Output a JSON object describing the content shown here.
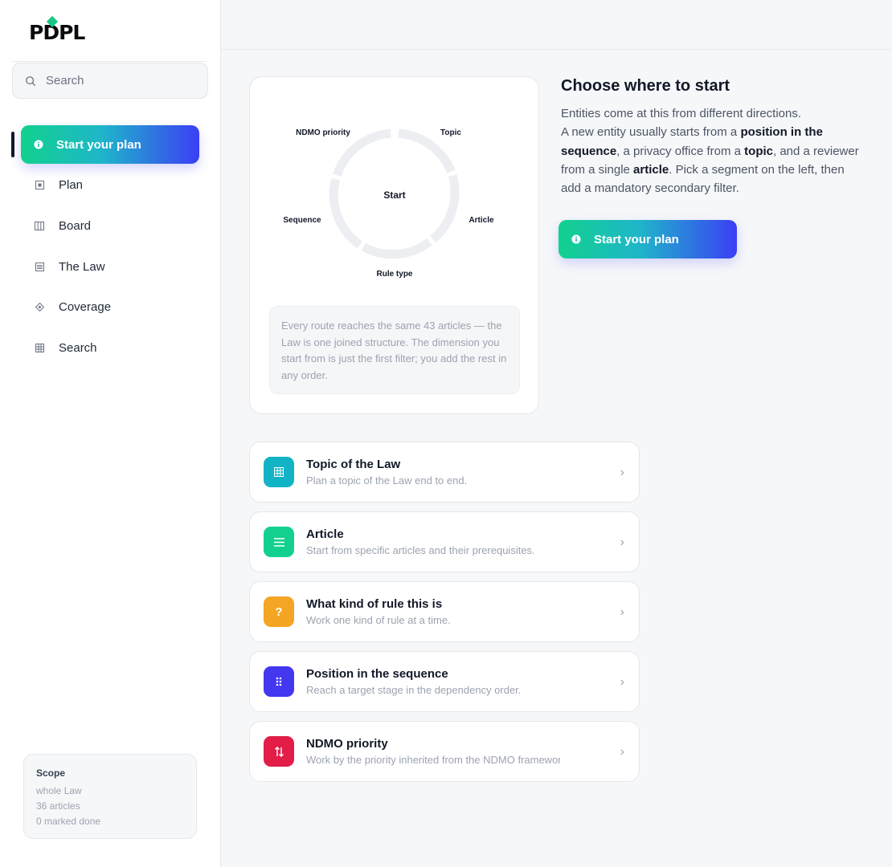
{
  "brand": {
    "logo": "PDPL"
  },
  "sidebar": {
    "search_placeholder": "Search",
    "active_item": {
      "label": "Start your plan",
      "icon": "info-circle-icon"
    },
    "items": [
      {
        "label": "Plan",
        "icon": "plan-square-icon"
      },
      {
        "label": "Board",
        "icon": "board-columns-icon"
      },
      {
        "label": "The Law",
        "icon": "law-lines-icon"
      },
      {
        "label": "Coverage",
        "icon": "coverage-diamond-icon"
      },
      {
        "label": "Search",
        "icon": "search-grid-icon"
      }
    ],
    "scope": {
      "title": "Scope",
      "lines": [
        "whole Law",
        "36 articles",
        "0 marked done"
      ]
    }
  },
  "wheel": {
    "center": "Start",
    "segments": [
      "NDMO priority",
      "Topic",
      "Article",
      "Rule type",
      "Sequence"
    ],
    "note": "Every route reaches the same 43 articles — the Law is one joined structure. The dimension you start from is just the first filter; you add the rest in any order."
  },
  "intro": {
    "title": "Choose where to start",
    "p1": "Entities come at this from different directions.",
    "p2_a": "A new entity usually starts from a ",
    "p2_b": "position in the sequence",
    "p2_c": ", a privacy office from a ",
    "p2_d": "topic",
    "p2_e": ", and a reviewer from a single ",
    "p2_f": "article",
    "p2_g": ". Pick a segment on the left, then add a mandatory secondary filter."
  },
  "cta": {
    "label": "Start your plan",
    "icon": "info-circle-icon"
  },
  "options": [
    {
      "title": "Topic of the Law",
      "desc": "Plan a topic of the Law end to end.",
      "icon": "grid-icon",
      "color": "#12b3c4"
    },
    {
      "title": "Article",
      "desc": "Start from specific articles and their prerequisites.",
      "icon": "list-icon",
      "color": "#12d18e"
    },
    {
      "title": "What kind of rule this is",
      "desc": "Work one kind of rule at a time.",
      "icon": "question-icon",
      "color": "#f5a524"
    },
    {
      "title": "Position in the sequence",
      "desc": "Reach a target stage in the dependency order.",
      "icon": "dots-icon",
      "color": "#4338f0"
    },
    {
      "title": "NDMO priority",
      "desc": "Work by the priority inherited from the NDMO framework.",
      "icon": "sort-arrows-icon",
      "color": "#e11d48"
    }
  ],
  "colors": {
    "accent_start": "#12d18e",
    "accent_end": "#3b3ff5"
  }
}
